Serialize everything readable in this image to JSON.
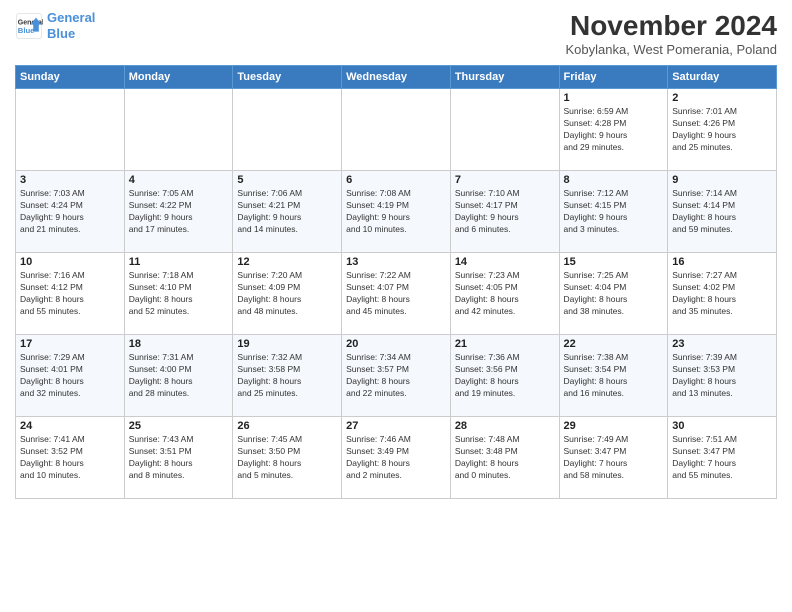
{
  "header": {
    "logo_line1": "General",
    "logo_line2": "Blue",
    "month_title": "November 2024",
    "subtitle": "Kobylanka, West Pomerania, Poland"
  },
  "weekdays": [
    "Sunday",
    "Monday",
    "Tuesday",
    "Wednesday",
    "Thursday",
    "Friday",
    "Saturday"
  ],
  "weeks": [
    [
      {
        "day": "",
        "info": ""
      },
      {
        "day": "",
        "info": ""
      },
      {
        "day": "",
        "info": ""
      },
      {
        "day": "",
        "info": ""
      },
      {
        "day": "",
        "info": ""
      },
      {
        "day": "1",
        "info": "Sunrise: 6:59 AM\nSunset: 4:28 PM\nDaylight: 9 hours\nand 29 minutes."
      },
      {
        "day": "2",
        "info": "Sunrise: 7:01 AM\nSunset: 4:26 PM\nDaylight: 9 hours\nand 25 minutes."
      }
    ],
    [
      {
        "day": "3",
        "info": "Sunrise: 7:03 AM\nSunset: 4:24 PM\nDaylight: 9 hours\nand 21 minutes."
      },
      {
        "day": "4",
        "info": "Sunrise: 7:05 AM\nSunset: 4:22 PM\nDaylight: 9 hours\nand 17 minutes."
      },
      {
        "day": "5",
        "info": "Sunrise: 7:06 AM\nSunset: 4:21 PM\nDaylight: 9 hours\nand 14 minutes."
      },
      {
        "day": "6",
        "info": "Sunrise: 7:08 AM\nSunset: 4:19 PM\nDaylight: 9 hours\nand 10 minutes."
      },
      {
        "day": "7",
        "info": "Sunrise: 7:10 AM\nSunset: 4:17 PM\nDaylight: 9 hours\nand 6 minutes."
      },
      {
        "day": "8",
        "info": "Sunrise: 7:12 AM\nSunset: 4:15 PM\nDaylight: 9 hours\nand 3 minutes."
      },
      {
        "day": "9",
        "info": "Sunrise: 7:14 AM\nSunset: 4:14 PM\nDaylight: 8 hours\nand 59 minutes."
      }
    ],
    [
      {
        "day": "10",
        "info": "Sunrise: 7:16 AM\nSunset: 4:12 PM\nDaylight: 8 hours\nand 55 minutes."
      },
      {
        "day": "11",
        "info": "Sunrise: 7:18 AM\nSunset: 4:10 PM\nDaylight: 8 hours\nand 52 minutes."
      },
      {
        "day": "12",
        "info": "Sunrise: 7:20 AM\nSunset: 4:09 PM\nDaylight: 8 hours\nand 48 minutes."
      },
      {
        "day": "13",
        "info": "Sunrise: 7:22 AM\nSunset: 4:07 PM\nDaylight: 8 hours\nand 45 minutes."
      },
      {
        "day": "14",
        "info": "Sunrise: 7:23 AM\nSunset: 4:05 PM\nDaylight: 8 hours\nand 42 minutes."
      },
      {
        "day": "15",
        "info": "Sunrise: 7:25 AM\nSunset: 4:04 PM\nDaylight: 8 hours\nand 38 minutes."
      },
      {
        "day": "16",
        "info": "Sunrise: 7:27 AM\nSunset: 4:02 PM\nDaylight: 8 hours\nand 35 minutes."
      }
    ],
    [
      {
        "day": "17",
        "info": "Sunrise: 7:29 AM\nSunset: 4:01 PM\nDaylight: 8 hours\nand 32 minutes."
      },
      {
        "day": "18",
        "info": "Sunrise: 7:31 AM\nSunset: 4:00 PM\nDaylight: 8 hours\nand 28 minutes."
      },
      {
        "day": "19",
        "info": "Sunrise: 7:32 AM\nSunset: 3:58 PM\nDaylight: 8 hours\nand 25 minutes."
      },
      {
        "day": "20",
        "info": "Sunrise: 7:34 AM\nSunset: 3:57 PM\nDaylight: 8 hours\nand 22 minutes."
      },
      {
        "day": "21",
        "info": "Sunrise: 7:36 AM\nSunset: 3:56 PM\nDaylight: 8 hours\nand 19 minutes."
      },
      {
        "day": "22",
        "info": "Sunrise: 7:38 AM\nSunset: 3:54 PM\nDaylight: 8 hours\nand 16 minutes."
      },
      {
        "day": "23",
        "info": "Sunrise: 7:39 AM\nSunset: 3:53 PM\nDaylight: 8 hours\nand 13 minutes."
      }
    ],
    [
      {
        "day": "24",
        "info": "Sunrise: 7:41 AM\nSunset: 3:52 PM\nDaylight: 8 hours\nand 10 minutes."
      },
      {
        "day": "25",
        "info": "Sunrise: 7:43 AM\nSunset: 3:51 PM\nDaylight: 8 hours\nand 8 minutes."
      },
      {
        "day": "26",
        "info": "Sunrise: 7:45 AM\nSunset: 3:50 PM\nDaylight: 8 hours\nand 5 minutes."
      },
      {
        "day": "27",
        "info": "Sunrise: 7:46 AM\nSunset: 3:49 PM\nDaylight: 8 hours\nand 2 minutes."
      },
      {
        "day": "28",
        "info": "Sunrise: 7:48 AM\nSunset: 3:48 PM\nDaylight: 8 hours\nand 0 minutes."
      },
      {
        "day": "29",
        "info": "Sunrise: 7:49 AM\nSunset: 3:47 PM\nDaylight: 7 hours\nand 58 minutes."
      },
      {
        "day": "30",
        "info": "Sunrise: 7:51 AM\nSunset: 3:47 PM\nDaylight: 7 hours\nand 55 minutes."
      }
    ]
  ]
}
